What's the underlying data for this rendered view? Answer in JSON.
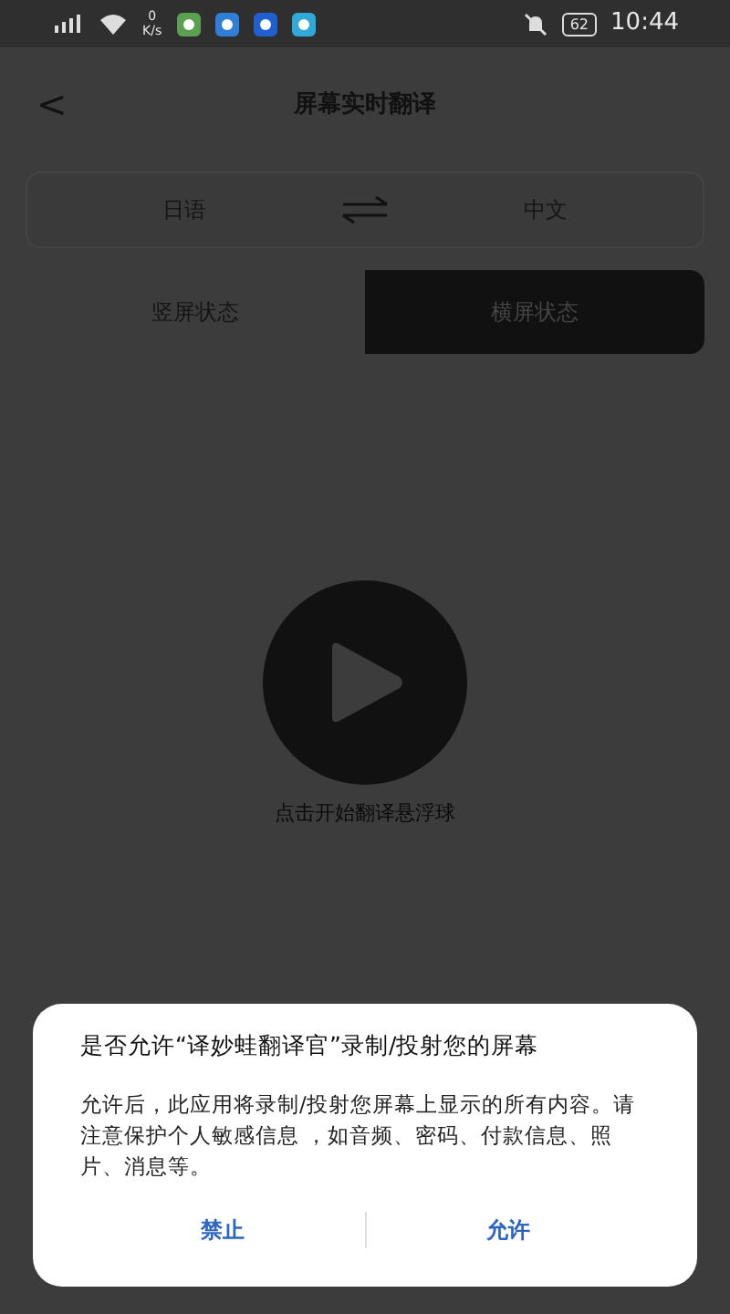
{
  "status_bar": {
    "speed_value": "0",
    "speed_unit": "K/s",
    "battery": "62",
    "time": "10:44"
  },
  "header": {
    "back": "<",
    "title": "屏幕实时翻译"
  },
  "languages": {
    "source": "日语",
    "target": "中文"
  },
  "tabs": [
    {
      "label": "竖屏状态",
      "selected": false
    },
    {
      "label": "横屏状态",
      "selected": true
    }
  ],
  "player": {
    "caption": "点击开始翻译悬浮球"
  },
  "dialog": {
    "title": "是否允许“译妙蛙翻译官”录制/投射您的屏幕",
    "message": "允许后，此应用将录制/投射您屏幕上显示的所有内容。请注意保护个人敏感信息 ，如音频、密码、付款信息、照片、消息等。",
    "buttons": [
      "禁止",
      "允许"
    ]
  }
}
